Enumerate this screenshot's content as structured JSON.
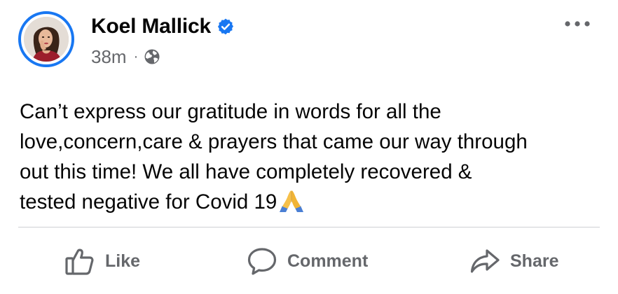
{
  "post": {
    "author": {
      "name": "Koel Mallick",
      "verified": true,
      "avatar_ring_color": "#1877f2"
    },
    "timestamp": "38m",
    "separator": "·",
    "audience_icon": "globe-icon",
    "more_icon": "more-horizontal-icon",
    "text_lines": [
      "Can’t express our gratitude in words for all the",
      "love,concern,care & prayers that came our way through",
      "out this time! We all have completely recovered &",
      "tested negative for Covid 19"
    ],
    "trailing_emoji": "folded-hands-emoji"
  },
  "actions": {
    "like": {
      "label": "Like",
      "icon": "thumbs-up-icon"
    },
    "comment": {
      "label": "Comment",
      "icon": "comment-bubble-icon"
    },
    "share": {
      "label": "Share",
      "icon": "share-arrow-icon"
    }
  },
  "colors": {
    "text_primary": "#050505",
    "text_secondary": "#65676b",
    "accent": "#1877f2",
    "divider": "#ced0d4"
  }
}
